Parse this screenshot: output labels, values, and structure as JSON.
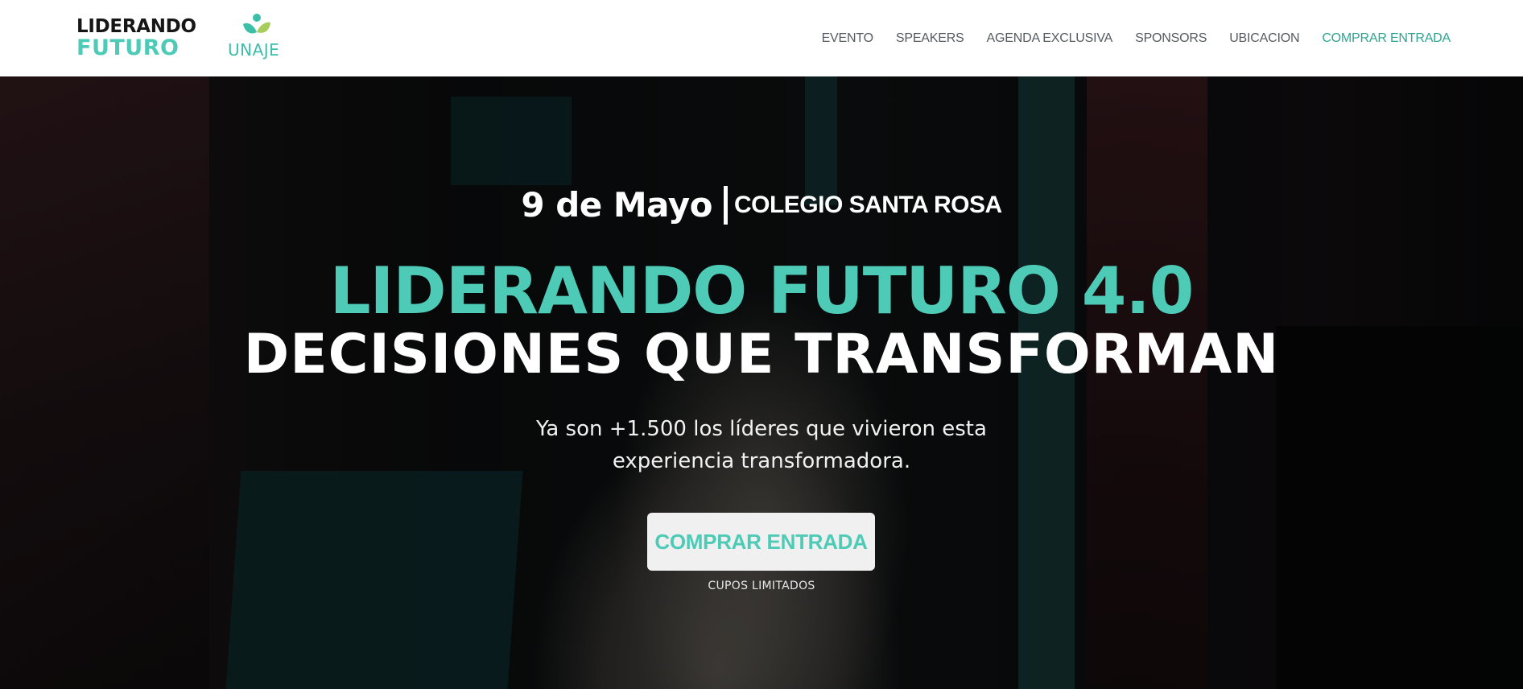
{
  "header": {
    "logo_line1": "LIDERANDO",
    "logo_line2": "FUTURO",
    "partner_logo_text": "UNAJE",
    "nav": [
      {
        "label": "EVENTO"
      },
      {
        "label": "SPEAKERS"
      },
      {
        "label": "AGENDA EXCLUSIVA"
      },
      {
        "label": "SPONSORS"
      },
      {
        "label": "UBICACION"
      },
      {
        "label": "COMPRAR ENTRADA"
      }
    ]
  },
  "hero": {
    "date": "9 de Mayo",
    "venue": "COLEGIO SANTA ROSA",
    "title": "LIDERANDO FUTURO 4.0",
    "subtitle": "DECISIONES QUE TRANSFORMAN",
    "blurb_line1": "Ya son +1.500 los líderes que vivieron esta",
    "blurb_line2": "experiencia transformadora.",
    "cta_label": "COMPRAR ENTRADA",
    "cta_note": "CUPOS LIMITADOS"
  },
  "colors": {
    "accent": "#4ecbb7",
    "nav_accent": "#2ea493",
    "nav_text": "#555b60",
    "header_bg": "#ffffff"
  }
}
